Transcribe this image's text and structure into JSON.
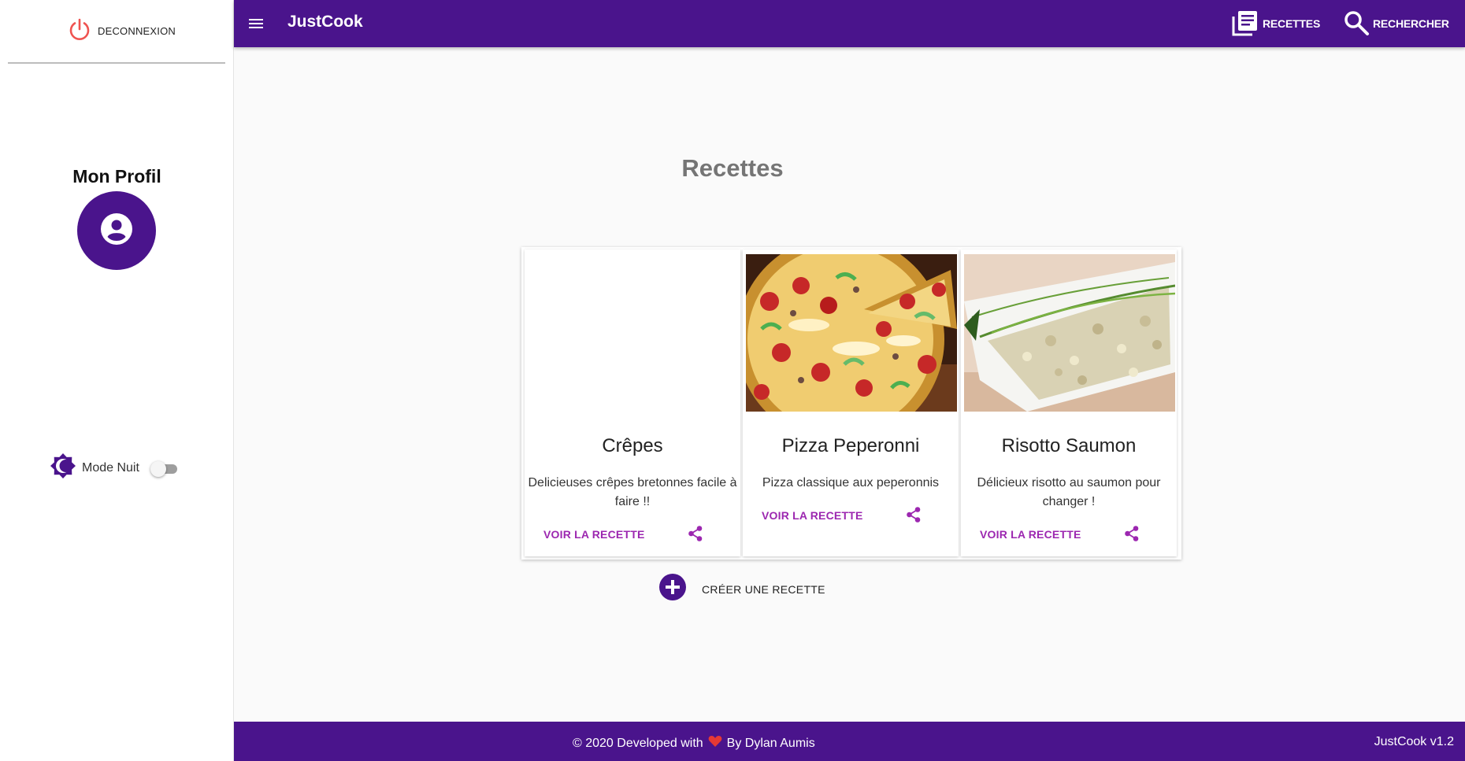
{
  "colors": {
    "primary": "#4a148c",
    "accent": "#9c27b0",
    "logout_red": "#ef5350",
    "heart": "#e53935"
  },
  "sidebar": {
    "logout_label": "DECONNEXION",
    "logout_icon": "power-icon",
    "profile_title": "Mon Profil",
    "avatar_icon": "account-circle-icon",
    "night_mode_label": "Mode Nuit",
    "night_mode_icon": "brightness-icon",
    "night_mode_on": false
  },
  "header": {
    "menu_icon": "hamburger-icon",
    "brand": "JustCook",
    "nav": [
      {
        "label": "RECETTES",
        "icon": "recipe-book-icon"
      },
      {
        "label": "RECHERCHER",
        "icon": "search-icon"
      }
    ]
  },
  "main": {
    "title": "Recettes",
    "recipes": [
      {
        "title": "Crêpes",
        "description": "Delicieuses crêpes bretonnes facile à faire !!",
        "link": "VOIR LA RECETTE",
        "image": "blank"
      },
      {
        "title": "Pizza Peperonni",
        "description": "Pizza classique aux peperonnis",
        "link": "VOIR LA RECETTE",
        "image": "pizza-photo"
      },
      {
        "title": "Risotto Saumon",
        "description": "Délicieux risotto au saumon pour changer !",
        "link": "VOIR LA RECETTE",
        "image": "risotto-photo"
      }
    ],
    "create_label": "CRÉER UNE RECETTE"
  },
  "footer": {
    "credit_prefix": "© 2020 Developed with",
    "credit_suffix": "By Dylan Aumis",
    "version": "JustCook v1.2"
  }
}
